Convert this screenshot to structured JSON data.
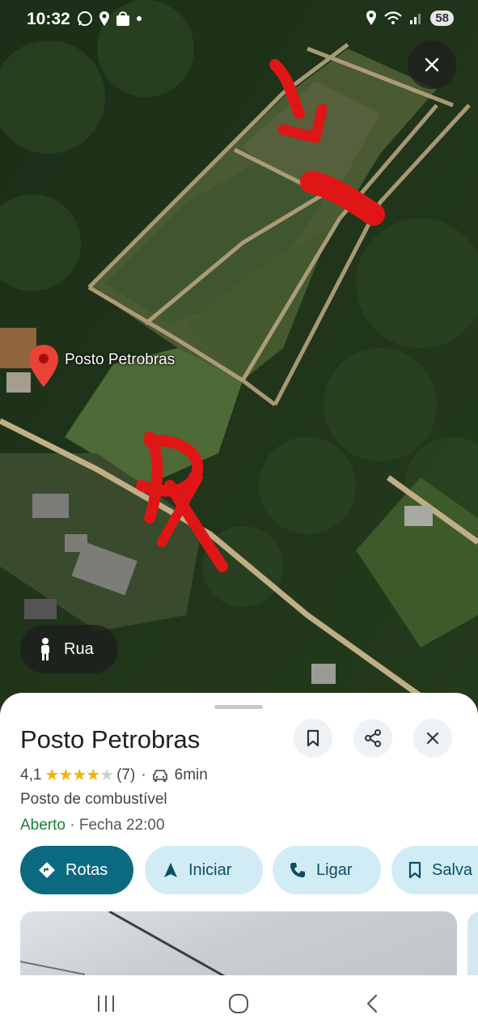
{
  "status_bar": {
    "time": "10:32",
    "battery": "58"
  },
  "map": {
    "pin_label": "Posto Petrobras",
    "street_view_label": "Rua"
  },
  "place": {
    "name": "Posto Petrobras",
    "rating": "4,1",
    "rating_value": 4.1,
    "review_count": "(7)",
    "separator": "·",
    "drive_time": "6min",
    "category": "Posto de combustível",
    "status": "Aberto",
    "status_sep": " · ",
    "hours": "Fecha 22:00"
  },
  "actions": {
    "rotas": "Rotas",
    "iniciar": "Iniciar",
    "ligar": "Ligar",
    "salvar": "Salva"
  },
  "colors": {
    "primary": "#0b6a80",
    "chip_bg": "#d2ecf6",
    "open": "#188038",
    "star": "#f4b400"
  }
}
